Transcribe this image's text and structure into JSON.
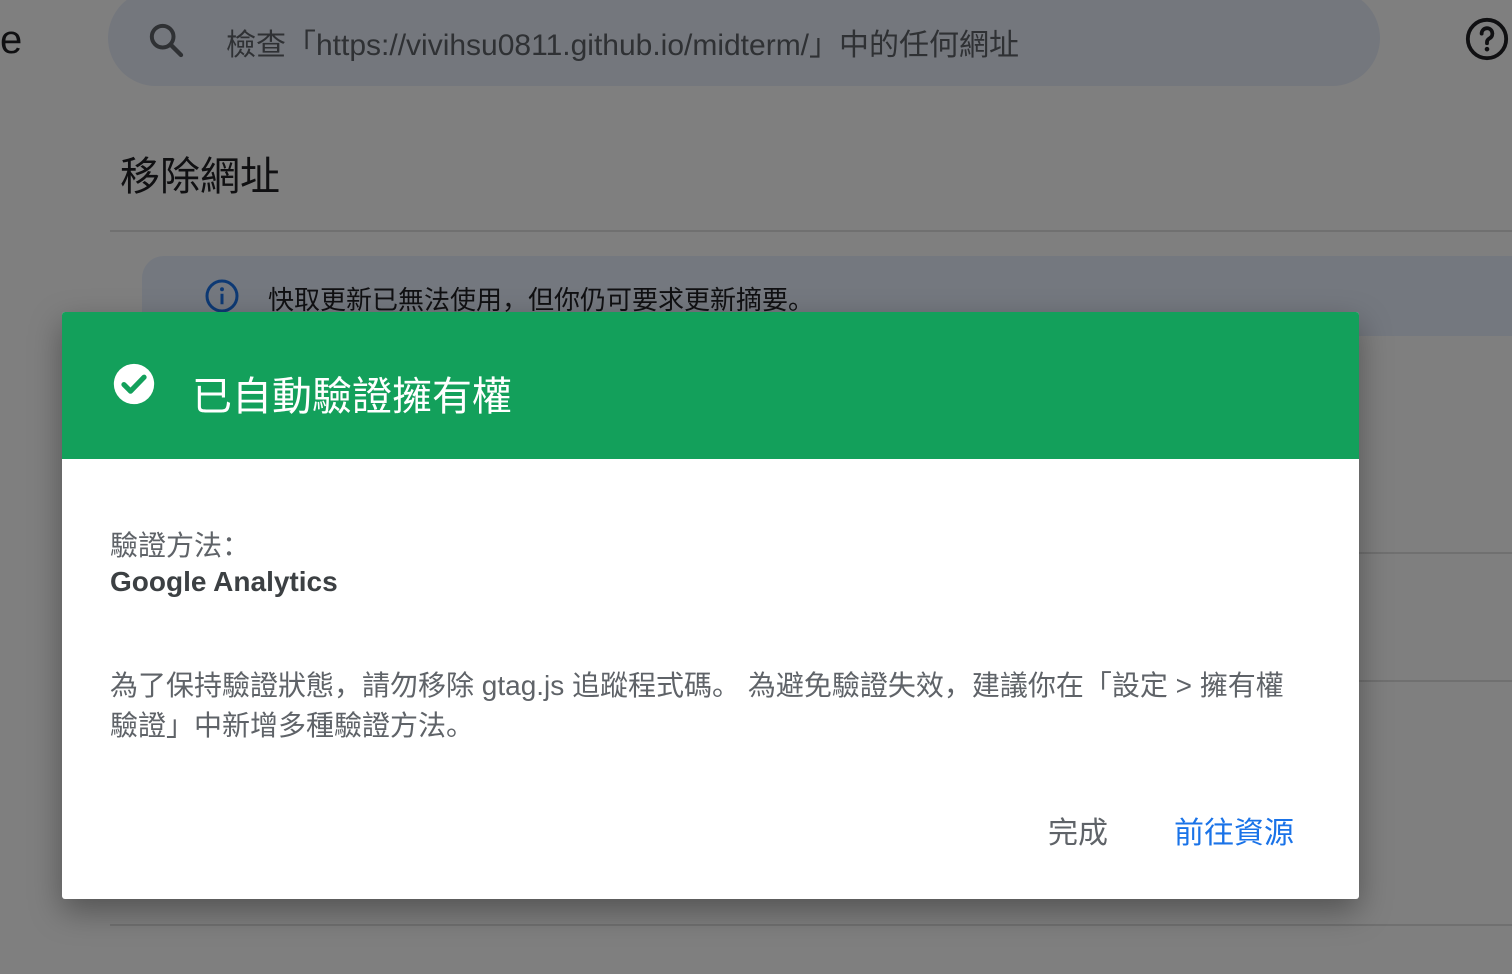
{
  "background": {
    "left_fragment": "e",
    "search": {
      "placeholder": "檢查「https://vivihsu0811.github.io/midterm/」中的任何網址"
    },
    "page_title": "移除網址",
    "info_banner": {
      "text": "快取更新已無法使用，但你仍可要求更新摘要。"
    }
  },
  "dialog": {
    "title": "已自動驗證擁有權",
    "method_label": "驗證方法：",
    "method_value": "Google Analytics",
    "body": "為了保持驗證狀態，請勿移除 gtag.js 追蹤程式碼。 為避免驗證失效，建議你在「設定 > 擁有權驗證」中新增多種驗證方法。",
    "buttons": {
      "done": "完成",
      "go_to_property": "前往資源"
    }
  },
  "colors": {
    "success_header": "#13a05b",
    "primary_link": "#1a73e8",
    "search_bg": "#e8eefb",
    "info_bg": "#e8f0fe",
    "info_icon": "#1a73e8"
  },
  "icons": {
    "search": "search-icon",
    "help": "help-circle-icon",
    "info": "info-icon",
    "check": "check-circle-icon"
  }
}
